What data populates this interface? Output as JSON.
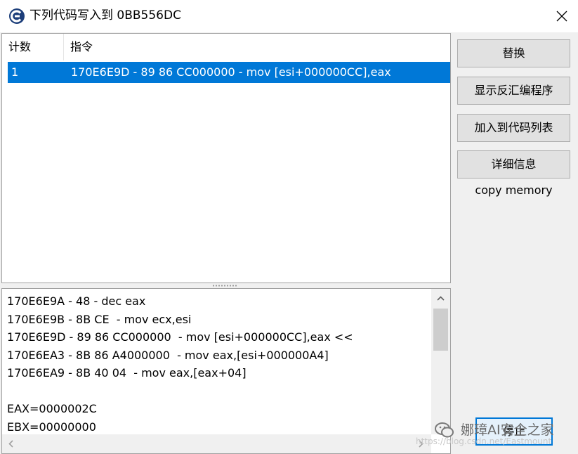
{
  "window": {
    "title": "下列代码写入到 0BB556DC",
    "icon": "cheat-engine-icon",
    "close_icon": "close-icon"
  },
  "list": {
    "headers": {
      "count": "计数",
      "instruction": "指令"
    },
    "rows": [
      {
        "count": "1",
        "instruction": "170E6E9D - 89 86 CC000000  - mov [esi+000000CC],eax",
        "selected": true
      }
    ]
  },
  "disassembly": {
    "lines": [
      "170E6E9A - 48 - dec eax",
      "170E6E9B - 8B CE  - mov ecx,esi",
      "170E6E9D - 89 86 CC000000  - mov [esi+000000CC],eax <<",
      "170E6EA3 - 8B 86 A4000000  - mov eax,[esi+000000A4]",
      "170E6EA9 - 8B 40 04  - mov eax,[eax+04]",
      "",
      "EAX=0000002C",
      "EBX=00000000"
    ]
  },
  "buttons": {
    "replace": "替换",
    "show_disassembler": "显示反汇编程序",
    "add_to_codelist": "加入到代码列表",
    "more_info": "详细信息",
    "stop": "停止"
  },
  "comment": "copy memory",
  "watermark": {
    "text": "娜璋AI安全之家",
    "url": "https://blog.csdn.net/Eastmount"
  },
  "colors": {
    "selection": "#0078d7",
    "window_bg": "#f0f0f0",
    "button_bg": "#e1e1e1",
    "stop_border": "#0078d7"
  }
}
